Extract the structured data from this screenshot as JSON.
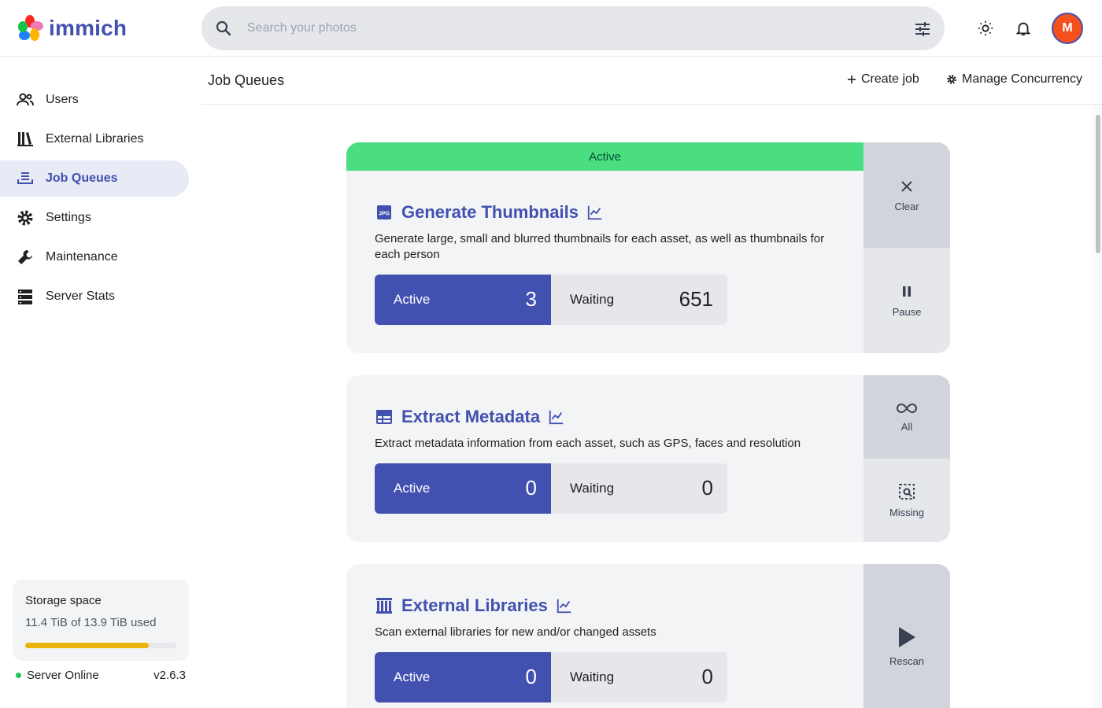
{
  "app": {
    "name": "immich"
  },
  "search": {
    "placeholder": "Search your photos"
  },
  "user": {
    "initial": "M"
  },
  "sidebar": {
    "items": [
      {
        "label": "Users",
        "icon": "users-icon",
        "active": false
      },
      {
        "label": "External Libraries",
        "icon": "library-icon",
        "active": false
      },
      {
        "label": "Job Queues",
        "icon": "queue-icon",
        "active": true
      },
      {
        "label": "Settings",
        "icon": "gear-icon",
        "active": false
      },
      {
        "label": "Maintenance",
        "icon": "wrench-icon",
        "active": false
      },
      {
        "label": "Server Stats",
        "icon": "server-icon",
        "active": false
      }
    ],
    "storage": {
      "title": "Storage space",
      "used": "11.4 TiB of 13.9 TiB used",
      "fraction": 0.82
    },
    "server": {
      "status": "Server Online",
      "version": "v2.6.3"
    }
  },
  "main": {
    "title": "Job Queues",
    "create_job": "Create job",
    "manage_concurrency": "Manage Concurrency"
  },
  "jobs": [
    {
      "status": "Active",
      "title": "Generate Thumbnails",
      "description": "Generate large, small and blurred thumbnails for each asset, as well as thumbnails for each person",
      "active_label": "Active",
      "active_count": "3",
      "waiting_label": "Waiting",
      "waiting_count": "651",
      "actions": [
        {
          "label": "Clear",
          "icon": "close-icon"
        },
        {
          "label": "Pause",
          "icon": "pause-icon"
        }
      ]
    },
    {
      "title": "Extract Metadata",
      "description": "Extract metadata information from each asset, such as GPS, faces and resolution",
      "active_label": "Active",
      "active_count": "0",
      "waiting_label": "Waiting",
      "waiting_count": "0",
      "actions": [
        {
          "label": "All",
          "icon": "infinity-icon"
        },
        {
          "label": "Missing",
          "icon": "search-missing-icon"
        }
      ]
    },
    {
      "title": "External Libraries",
      "description": "Scan external libraries for new and/or changed assets",
      "active_label": "Active",
      "active_count": "0",
      "waiting_label": "Waiting",
      "waiting_count": "0",
      "actions": [
        {
          "label": "Rescan",
          "icon": "play-icon"
        }
      ]
    }
  ],
  "colors": {
    "accent": "#4250af",
    "active_strip": "#4ade80",
    "storage_bar": "#eab308",
    "online": "#22c55e",
    "avatar": "#f4511e"
  }
}
